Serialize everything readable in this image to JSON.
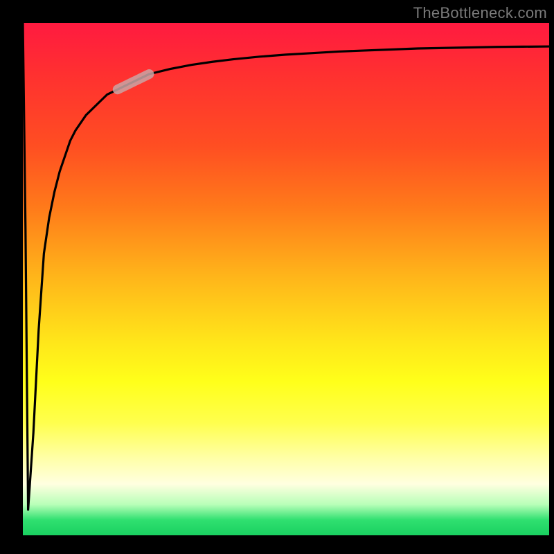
{
  "watermark": "TheBottleneck.com",
  "chart_data": {
    "type": "line",
    "title": "",
    "xlabel": "",
    "ylabel": "",
    "xlim": [
      0,
      100
    ],
    "ylim": [
      0,
      100
    ],
    "grid": false,
    "legend": false,
    "series": [
      {
        "name": "curve",
        "x": [
          0,
          0.5,
          1,
          2,
          3,
          4,
          5,
          6,
          7,
          8,
          9,
          10,
          12,
          14,
          16,
          18,
          20,
          24,
          28,
          32,
          36,
          40,
          45,
          50,
          55,
          60,
          65,
          70,
          75,
          80,
          85,
          90,
          95,
          100
        ],
        "values": [
          100,
          60,
          5,
          20,
          40,
          55,
          62,
          67,
          71,
          74,
          77,
          79,
          82,
          84,
          86,
          87,
          88,
          90,
          91,
          91.8,
          92.4,
          92.9,
          93.4,
          93.8,
          94.1,
          94.4,
          94.6,
          94.8,
          95.0,
          95.1,
          95.2,
          95.3,
          95.35,
          95.4
        ]
      }
    ],
    "highlight": {
      "name": "highlight-segment",
      "x_start": 18,
      "x_end": 24
    },
    "background_gradient": {
      "top": "#ff1a40",
      "mid": "#ffff1a",
      "bottom": "#1ad060"
    },
    "frame_color": "#000000"
  }
}
